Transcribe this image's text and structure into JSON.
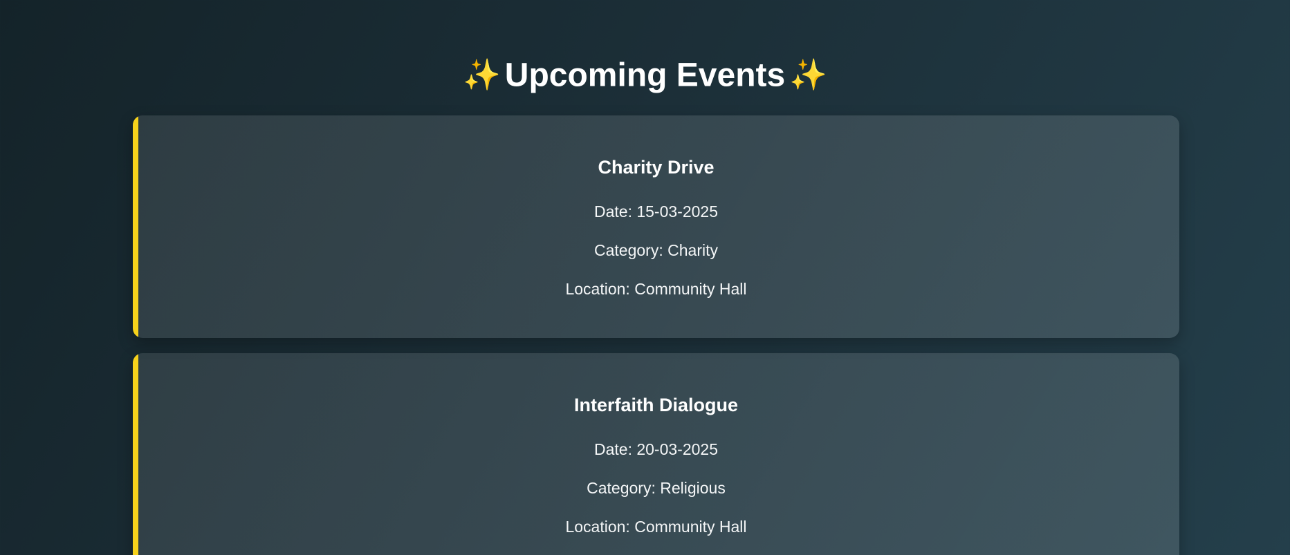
{
  "header": {
    "title": "Upcoming Events",
    "sparkle_left": "✨",
    "sparkle_right": "✨"
  },
  "colors": {
    "accent": "#f7d21b",
    "sparkle": "#f6c84c",
    "background_start": "#142329",
    "background_end": "#243f4b"
  },
  "events": [
    {
      "title": "Charity Drive",
      "date": "Date: 15-03-2025",
      "category": "Category: Charity",
      "location": "Location: Community Hall"
    },
    {
      "title": "Interfaith Dialogue",
      "date": "Date: 20-03-2025",
      "category": "Category: Religious",
      "location": "Location: Community Hall"
    }
  ]
}
